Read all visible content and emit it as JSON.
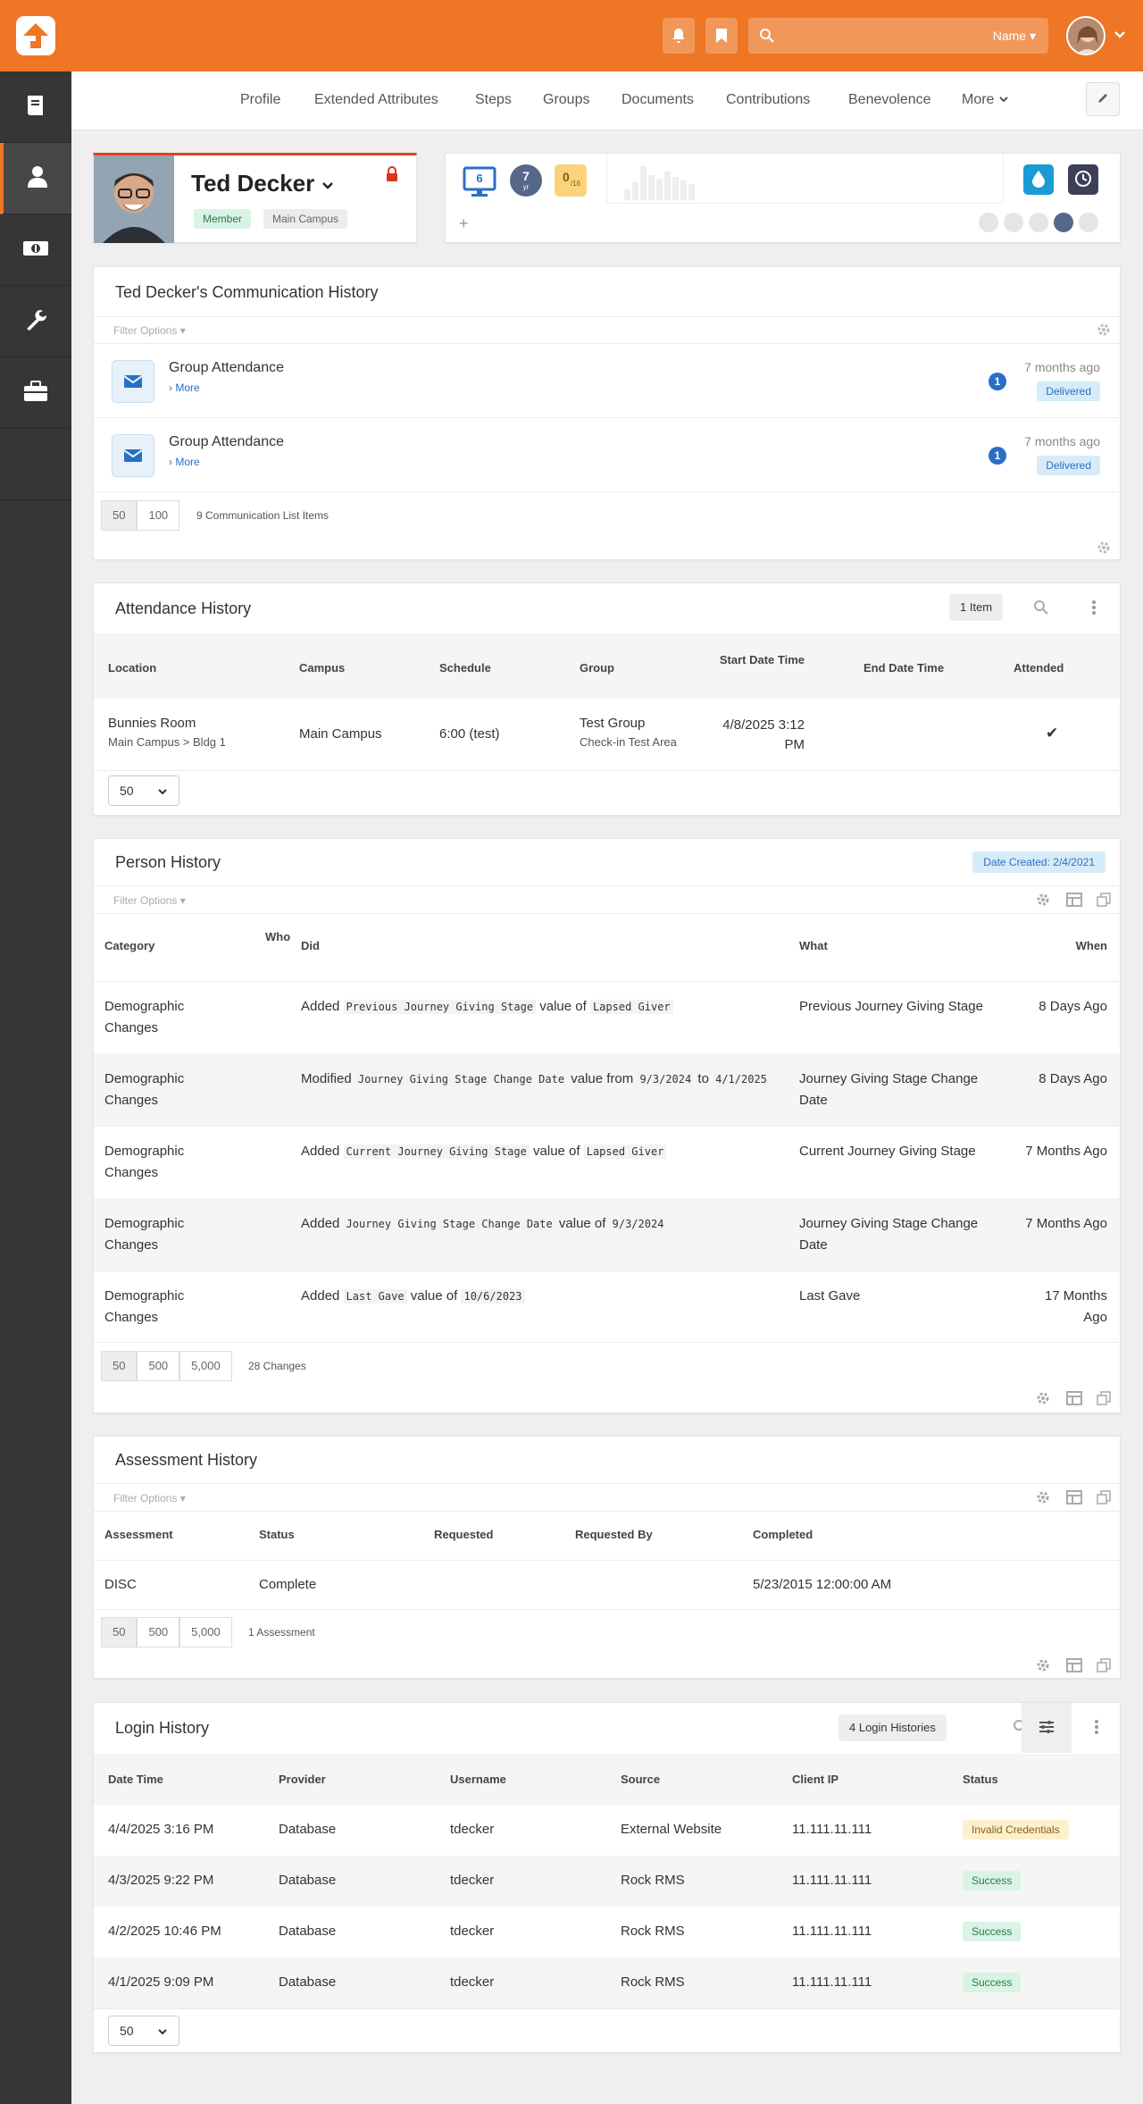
{
  "topbar": {
    "search_scope": "Name"
  },
  "subnav": {
    "items": [
      "Profile",
      "Extended Attributes",
      "Steps",
      "Groups",
      "Documents",
      "Contributions",
      "Benevolence",
      "More"
    ]
  },
  "person": {
    "name": "Ted Decker",
    "badges": [
      "Member",
      "Main Campus"
    ]
  },
  "indicators": {
    "monitor_count": "6",
    "bubble_value": "7",
    "bubble_sub": "yr",
    "streak_value": "0",
    "streak_sub": "/16",
    "add": "+"
  },
  "colors": {
    "accent": "#ee7624",
    "sidebar": "#363636",
    "success": "#2c7a4b",
    "warning": "#8a6116",
    "link": "#2a6fc6"
  },
  "comm": {
    "title": "Ted Decker's Communication History",
    "filter": "Filter Options",
    "items": [
      {
        "title": "Group Attendance",
        "more": "More",
        "count": "1",
        "time": "7 months ago",
        "status": "Delivered"
      },
      {
        "title": "Group Attendance",
        "more": "More",
        "count": "1",
        "time": "7 months ago",
        "status": "Delivered"
      }
    ],
    "pager": [
      "50",
      "100"
    ],
    "summary": "9 Communication List Items"
  },
  "attendance": {
    "title": "Attendance History",
    "count": "1 Item",
    "headers": [
      "Location",
      "Campus",
      "Schedule",
      "Group",
      "Start Date Time",
      "End Date Time",
      "Attended"
    ],
    "row": {
      "location": "Bunnies Room",
      "location_sub": "Main Campus > Bldg 1",
      "campus": "Main Campus",
      "schedule": "6:00 (test)",
      "group": "Test Group",
      "group_sub": "Check-in Test Area",
      "start": "4/8/2025 3:12 PM",
      "end": "",
      "attended": "✔"
    },
    "page_size": "50"
  },
  "person_history": {
    "title": "Person History",
    "date_created": "Date Created: 2/4/2021",
    "filter": "Filter Options",
    "headers": [
      "Category",
      "Who",
      "Did",
      "What",
      "When"
    ],
    "rows": [
      {
        "category": "Demographic Changes",
        "did_verb": "Added",
        "did_a": "Previous Journey Giving Stage",
        "did_mid": "value of",
        "did_b": "Lapsed Giver",
        "did_mid2": "",
        "did_c": "",
        "what": "Previous Journey Giving Stage",
        "when": "8 Days Ago"
      },
      {
        "category": "Demographic Changes",
        "did_verb": "Modified",
        "did_a": "Journey Giving Stage Change Date",
        "did_mid": "value from",
        "did_b": "9/3/2024",
        "did_mid2": "to",
        "did_c": "4/1/2025",
        "what": "Journey Giving Stage Change Date",
        "when": "8 Days Ago"
      },
      {
        "category": "Demographic Changes",
        "did_verb": "Added",
        "did_a": "Current Journey Giving Stage",
        "did_mid": "value of",
        "did_b": "Lapsed Giver",
        "did_mid2": "",
        "did_c": "",
        "what": "Current Journey Giving Stage",
        "when": "7 Months Ago"
      },
      {
        "category": "Demographic Changes",
        "did_verb": "Added",
        "did_a": "Journey Giving Stage Change Date",
        "did_mid": "value of",
        "did_b": "9/3/2024",
        "did_mid2": "",
        "did_c": "",
        "what": "Journey Giving Stage Change Date",
        "when": "7 Months Ago"
      },
      {
        "category": "Demographic Changes",
        "did_verb": "Added",
        "did_a": "Last Gave",
        "did_mid": "value of",
        "did_b": "10/6/2023",
        "did_mid2": "",
        "did_c": "",
        "what": "Last Gave",
        "when": "17 Months Ago"
      }
    ],
    "pager": [
      "50",
      "500",
      "5,000"
    ],
    "summary": "28 Changes"
  },
  "assessment": {
    "title": "Assessment History",
    "filter": "Filter Options",
    "headers": [
      "Assessment",
      "Status",
      "Requested",
      "Requested By",
      "Completed"
    ],
    "row": {
      "assessment": "DISC",
      "status": "Complete",
      "requested": "",
      "requested_by": "",
      "completed": "5/23/2015 12:00:00 AM"
    },
    "pager": [
      "50",
      "500",
      "5,000"
    ],
    "summary": "1 Assessment"
  },
  "login": {
    "title": "Login History",
    "count": "4 Login Histories",
    "headers": [
      "Date Time",
      "Provider",
      "Username",
      "Source",
      "Client IP",
      "Status"
    ],
    "rows": [
      {
        "date": "4/4/2025 3:16 PM",
        "provider": "Database",
        "username": "tdecker",
        "source": "External Website",
        "ip": "11.111.11.111",
        "status": "Invalid Credentials",
        "ok": false
      },
      {
        "date": "4/3/2025 9:22 PM",
        "provider": "Database",
        "username": "tdecker",
        "source": "Rock RMS",
        "ip": "11.111.11.111",
        "status": "Success",
        "ok": true
      },
      {
        "date": "4/2/2025 10:46 PM",
        "provider": "Database",
        "username": "tdecker",
        "source": "Rock RMS",
        "ip": "11.111.11.111",
        "status": "Success",
        "ok": true
      },
      {
        "date": "4/1/2025 9:09 PM",
        "provider": "Database",
        "username": "tdecker",
        "source": "Rock RMS",
        "ip": "11.111.11.111",
        "status": "Success",
        "ok": true
      }
    ],
    "page_size": "50"
  }
}
